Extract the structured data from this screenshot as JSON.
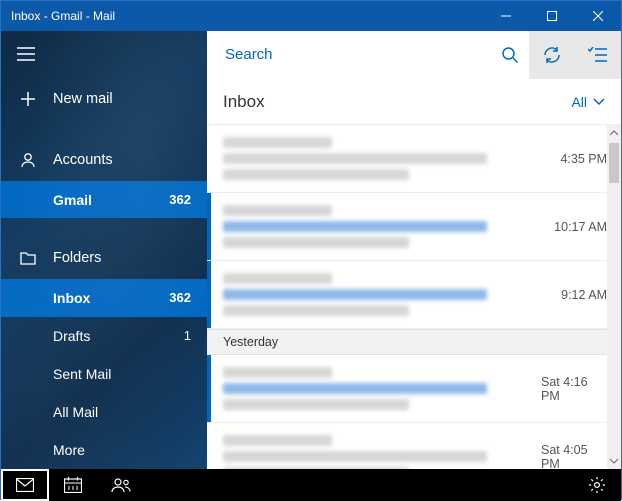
{
  "window": {
    "title": "Inbox - Gmail - Mail"
  },
  "sidebar": {
    "new_mail": "New mail",
    "accounts_label": "Accounts",
    "account": {
      "name": "Gmail",
      "count": "362"
    },
    "folders_label": "Folders",
    "folders": [
      {
        "label": "Inbox",
        "count": "362",
        "selected": true,
        "bold": true
      },
      {
        "label": "Drafts",
        "count": "1",
        "selected": false,
        "bold": false
      },
      {
        "label": "Sent Mail",
        "count": "",
        "selected": false,
        "bold": false
      },
      {
        "label": "All Mail",
        "count": "",
        "selected": false,
        "bold": false
      },
      {
        "label": "More",
        "count": "",
        "selected": false,
        "bold": false
      }
    ]
  },
  "search": {
    "placeholder": "Search"
  },
  "list": {
    "title": "Inbox",
    "filter": "All",
    "group_yesterday": "Yesterday",
    "items": [
      {
        "time": "4:35 PM",
        "unread": false
      },
      {
        "time": "10:17 AM",
        "unread": true
      },
      {
        "time": "9:12 AM",
        "unread": true
      },
      {
        "time": "Sat 4:16 PM",
        "unread": true
      },
      {
        "time": "Sat 4:05 PM",
        "unread": false
      }
    ]
  }
}
